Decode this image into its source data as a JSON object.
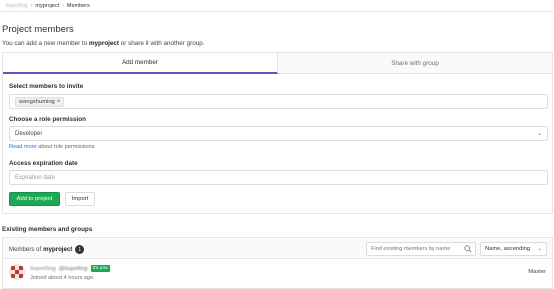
{
  "breadcrumb": {
    "group": "liupeifing",
    "project": "myproject",
    "current": "Members"
  },
  "page": {
    "title": "Project members",
    "subtitle_prefix": "You can add a new member to ",
    "subtitle_project": "myproject",
    "subtitle_suffix": " or share it with another group."
  },
  "tabs": [
    {
      "label": "Add member",
      "active": true
    },
    {
      "label": "Share with group",
      "active": false
    }
  ],
  "form": {
    "select_members_label": "Select members to invite",
    "selected_member": "wangshuming",
    "role_label": "Choose a role permission",
    "role_value": "Developer",
    "read_more_link": "Read more",
    "read_more_text": " about role permissions",
    "expiration_label": "Access expiration date",
    "expiration_placeholder": "Expiration date",
    "add_button": "Add to project",
    "import_button": "Import"
  },
  "existing": {
    "section_title": "Existing members and groups",
    "header_prefix": "Members of ",
    "header_project": "myproject",
    "count": "1",
    "search_placeholder": "Find existing members by name",
    "sort_value": "Name, ascending"
  },
  "members": [
    {
      "name": "liupeifing",
      "handle": "@liupeifing",
      "badge": "It's you",
      "joined": "Joined about 4 hours ago",
      "role": "Master"
    }
  ],
  "colors": {
    "accent_tab": "#6b4fbb",
    "primary_button": "#1aaa55",
    "link": "#1f78d1",
    "itsyou_badge": "#1aaa55"
  }
}
